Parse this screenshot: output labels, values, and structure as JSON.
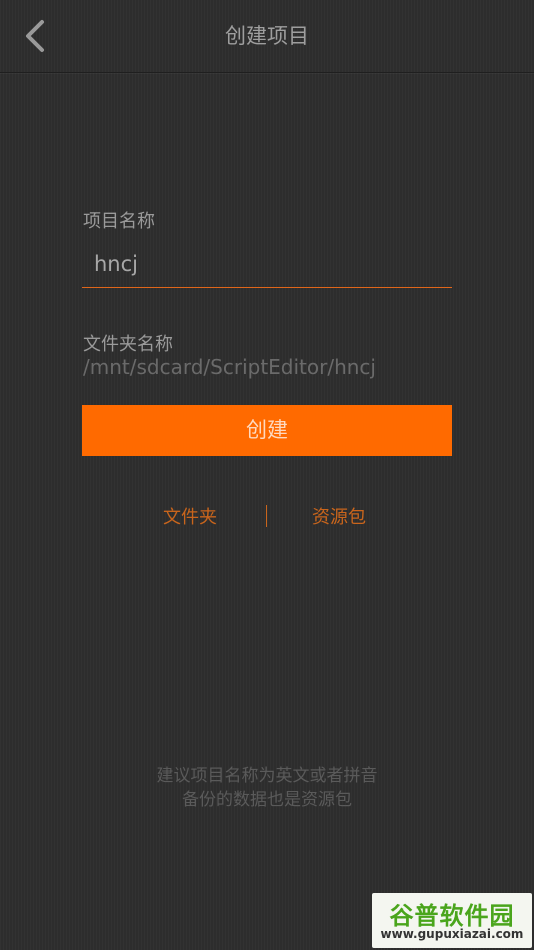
{
  "header": {
    "title": "创建项目",
    "back_icon": "chevron-left-icon"
  },
  "form": {
    "project_name_label": "项目名称",
    "project_name_value": "hncj",
    "folder_name_label": "文件夹名称",
    "folder_path": "/mnt/sdcard/ScriptEditor/hncj",
    "create_label": "创建"
  },
  "tabs": {
    "folder": "文件夹",
    "package": "资源包"
  },
  "hint": {
    "line1": "建议项目名称为英文或者拼音",
    "line2": "备份的数据也是资源包"
  },
  "watermark": {
    "logo_text": "谷普软件园",
    "url": "www.gupuxiazai.com"
  },
  "colors": {
    "background": "#2d2d2d",
    "accent": "#ff6a00",
    "accent_text": "#c9651c",
    "watermark_green": "#4aa51c"
  }
}
